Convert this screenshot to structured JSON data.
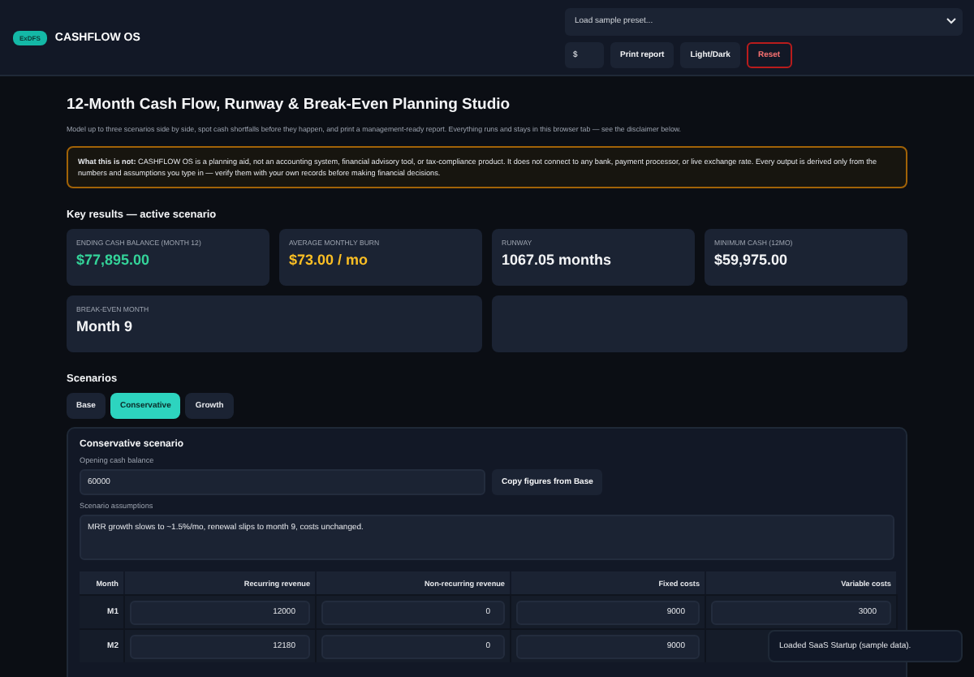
{
  "header": {
    "badge": "ExDFS",
    "brand": "CASHFLOW OS",
    "preset_select": {
      "value": "Load sample preset..."
    },
    "currency_field": {
      "value": "$"
    },
    "buttons": [
      {
        "label": "Print report",
        "kind": "normal"
      },
      {
        "label": "Light/Dark",
        "kind": "normal"
      },
      {
        "label": "Reset",
        "kind": "danger"
      }
    ]
  },
  "page": {
    "title": "12-Month Cash Flow, Runway & Break-Even Planning Studio",
    "intro": "Model up to three scenarios side by side, spot cash shortfalls before they happen, and print a management-ready report. Everything runs and stays in this browser tab — see the disclaimer below."
  },
  "disclaimer": "**What this is not:** CASHFLOW OS is a planning aid, not an accounting system, financial advisory tool, or tax-compliance product. It does not connect to any bank, payment processor, or live exchange rate. Every output is derived only from the numbers and assumptions you type in — verify them with your own records before making financial decisions.",
  "key_results": {
    "heading": "Key results — active scenario",
    "cards": [
      {
        "kind": "metric",
        "label": "ENDING CASH BALANCE (MONTH 12)",
        "value": "$77,895.00",
        "color": "#34d399",
        "wide": false
      },
      {
        "kind": "metric",
        "label": "AVERAGE MONTHLY BURN",
        "value": "$73.00 / mo",
        "color": "#fbbf24",
        "wide": false
      },
      {
        "kind": "metric",
        "label": "RUNWAY",
        "value": "1067.05 months",
        "color": "#f3f4f6",
        "wide": false
      },
      {
        "kind": "metric",
        "label": "MINIMUM CASH (12MO)",
        "value": "$59,975.00",
        "color": "#f3f4f6",
        "wide": false
      },
      {
        "kind": "metric",
        "label": "BREAK-EVEN MONTH",
        "value": "Month 9",
        "color": "#f3f4f6",
        "wide": true
      },
      {
        "kind": "empty",
        "wide": true
      }
    ]
  },
  "scenarios": {
    "heading": "Scenarios",
    "tabs": [
      {
        "label": "Base",
        "selected": false
      },
      {
        "label": "Conservative",
        "selected": true
      },
      {
        "label": "Growth",
        "selected": false
      }
    ],
    "panel": {
      "title": "Conservative scenario",
      "opening_label": "Opening cash balance",
      "opening_value": "60000",
      "copy_button": "Copy figures from Base",
      "assumptions_label": "Scenario assumptions",
      "assumptions_value": "MRR growth slows to ~1.5%/mo, renewal slips to month 9, costs unchanged.",
      "table": {
        "columns": [
          "Month",
          "Recurring revenue",
          "Non-recurring revenue",
          "Fixed costs",
          "Variable costs"
        ],
        "rows": [
          {
            "month": "M1",
            "values": [
              "12000",
              "0",
              "9000",
              "3000"
            ]
          },
          {
            "month": "M2",
            "values": [
              "12180",
              "0",
              "9000"
            ]
          }
        ]
      }
    }
  },
  "toast": "Loaded SaaS Startup (sample data)."
}
